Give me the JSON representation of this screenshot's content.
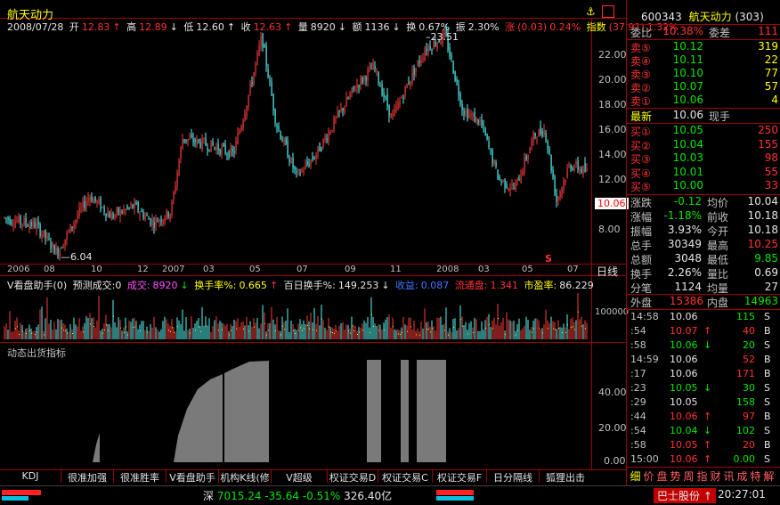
{
  "chart": {
    "stock_name": "航天动力",
    "date": "2008/07/28",
    "open_label": "开",
    "open": "12.83",
    "high_label": "高",
    "high": "12.89",
    "low_label": "低",
    "low": "12.60",
    "close_label": "收",
    "close": "12.63",
    "volume_label": "量",
    "volume": "8920",
    "amount_label": "额",
    "amount": "1136",
    "turnover_label": "换",
    "turnover": "0.67%",
    "amplitude_label": "振",
    "amplitude": "2.30%",
    "change_label": "涨",
    "change": "(0.03)",
    "change_pct": "0.24%",
    "index_label": "指数",
    "index_val": "(37.91)",
    "index_pct": "1.32%",
    "price_ticks": [
      "22.00",
      "20.00",
      "18.00",
      "16.00",
      "14.00",
      "12.00",
      "10.00",
      "8.00"
    ],
    "current_price_tag": "10.06",
    "high_annot": "23.51",
    "low_annot": "6.04",
    "date_ticks": [
      "2006",
      "08",
      "10",
      "12",
      "2007",
      "03",
      "05",
      "07",
      "09",
      "11",
      "2008",
      "03",
      "05",
      "07"
    ],
    "period_label": "日线",
    "marker_s": "S"
  },
  "volume_panel": {
    "title": "V看盘助手(0)",
    "forecast_label": "预测成交:0",
    "deal_label": "成交:",
    "deal_value": "8920",
    "turnover_label": "换手率%:",
    "turnover_value": "0.665",
    "hundred_day_label": "百日换手%:",
    "hundred_day_value": "149.253",
    "income_label": "收益:",
    "income_value": "0.087",
    "float_label": "流通盘:",
    "float_value": "1.341",
    "pe_label": "市盈率:",
    "pe_value": "86.229",
    "axis_label": "100000"
  },
  "indicator_panel": {
    "title": "动态出货指标",
    "ticks": [
      "40.00",
      "20.00",
      "0.00"
    ]
  },
  "bottom_tabs": [
    "KDJ",
    "很准加强",
    "很准胜率",
    "V看盘助手",
    "机构K线(修",
    "V超级MACD",
    "权证交易D",
    "权证交易C",
    "权证交易F",
    "日分隔线",
    "狐狸出击"
  ],
  "right_panel": {
    "code": "600343",
    "name": "航天动力",
    "rank": "(303)",
    "weibi_label": "委比",
    "weibi_value": "10.38%",
    "weicha_label": "委差",
    "weicha_value": "111",
    "sells": [
      {
        "label": "卖⑤",
        "price": "10.12",
        "vol": "319"
      },
      {
        "label": "卖④",
        "price": "10.11",
        "vol": "22"
      },
      {
        "label": "卖③",
        "price": "10.10",
        "vol": "77"
      },
      {
        "label": "卖②",
        "price": "10.07",
        "vol": "57"
      },
      {
        "label": "卖①",
        "price": "10.06",
        "vol": "4"
      }
    ],
    "last_label": "最新",
    "last_value": "10.06",
    "xianshou_label": "现手",
    "buys": [
      {
        "label": "买①",
        "price": "10.05",
        "vol": "250"
      },
      {
        "label": "买②",
        "price": "10.04",
        "vol": "155"
      },
      {
        "label": "买③",
        "price": "10.03",
        "vol": "98"
      },
      {
        "label": "买④",
        "price": "10.01",
        "vol": "55"
      },
      {
        "label": "买⑤",
        "price": "10.00",
        "vol": "33"
      }
    ],
    "stats": [
      {
        "l1": "涨跌",
        "v1": "-0.12",
        "c1": "grn",
        "l2": "均价",
        "v2": "10.04",
        "c2": "wht"
      },
      {
        "l1": "涨幅",
        "v1": "-1.18%",
        "c1": "grn",
        "l2": "前收",
        "v2": "10.18",
        "c2": "wht"
      },
      {
        "l1": "振幅",
        "v1": "3.93%",
        "c1": "wht",
        "l2": "今开",
        "v2": "10.18",
        "c2": "wht"
      },
      {
        "l1": "总手",
        "v1": "30349",
        "c1": "wht",
        "l2": "最高",
        "v2": "10.25",
        "c2": "red"
      },
      {
        "l1": "总额",
        "v1": "3048",
        "c1": "wht",
        "l2": "最低",
        "v2": "9.85",
        "c2": "grn"
      },
      {
        "l1": "换手",
        "v1": "2.26%",
        "c1": "wht",
        "l2": "量比",
        "v2": "0.69",
        "c2": "wht"
      },
      {
        "l1": "分笔",
        "v1": "1124",
        "c1": "wht",
        "l2": "均量",
        "v2": "27",
        "c2": "wht"
      }
    ],
    "outer_label": "外盘",
    "outer_value": "15386",
    "inner_label": "内盘",
    "inner_value": "14963",
    "ticks": [
      {
        "t": "14:58",
        "p": "10.06",
        "a": "",
        "n": "115",
        "f": "S",
        "pc": "wht",
        "fc": "wht"
      },
      {
        "t": ":54",
        "p": "10.07",
        "a": "↑",
        "n": "40",
        "f": "B",
        "pc": "red",
        "fc": "wht"
      },
      {
        "t": ":58",
        "p": "10.06",
        "a": "↓",
        "n": "20",
        "f": "S",
        "pc": "grn",
        "fc": "wht"
      },
      {
        "t": "14:59",
        "p": "10.06",
        "a": "",
        "n": "52",
        "f": "B",
        "pc": "wht",
        "fc": "wht"
      },
      {
        "t": ":17",
        "p": "10.06",
        "a": "",
        "n": "171",
        "f": "B",
        "pc": "wht",
        "fc": "wht"
      },
      {
        "t": ":23",
        "p": "10.05",
        "a": "↓",
        "n": "30",
        "f": "S",
        "pc": "grn",
        "fc": "wht"
      },
      {
        "t": ":29",
        "p": "10.05",
        "a": "",
        "n": "158",
        "f": "S",
        "pc": "wht",
        "fc": "wht"
      },
      {
        "t": ":44",
        "p": "10.06",
        "a": "↑",
        "n": "97",
        "f": "B",
        "pc": "red",
        "fc": "wht"
      },
      {
        "t": ":54",
        "p": "10.04",
        "a": "↓",
        "n": "102",
        "f": "S",
        "pc": "grn",
        "fc": "wht"
      },
      {
        "t": ":58",
        "p": "10.05",
        "a": "↑",
        "n": "20",
        "f": "B",
        "pc": "red",
        "fc": "wht"
      },
      {
        "t": "15:00",
        "p": "10.06",
        "a": "↑",
        "n": "0.00",
        "f": "S",
        "pc": "red",
        "fc": "wht"
      }
    ],
    "bottom_tabs": [
      "细",
      "价",
      "盘",
      "势",
      "周",
      "指",
      "财",
      "讯",
      "成",
      "特",
      "解"
    ]
  },
  "status_bar": {
    "index_name": "深",
    "index_value": "7015.24",
    "index_change": "-35.64",
    "index_pct": "-0.51%",
    "index_amount": "326.40亿",
    "ticker_name": "巴士股份",
    "ticker_arrow": "↑",
    "time": "20:27:01"
  }
}
